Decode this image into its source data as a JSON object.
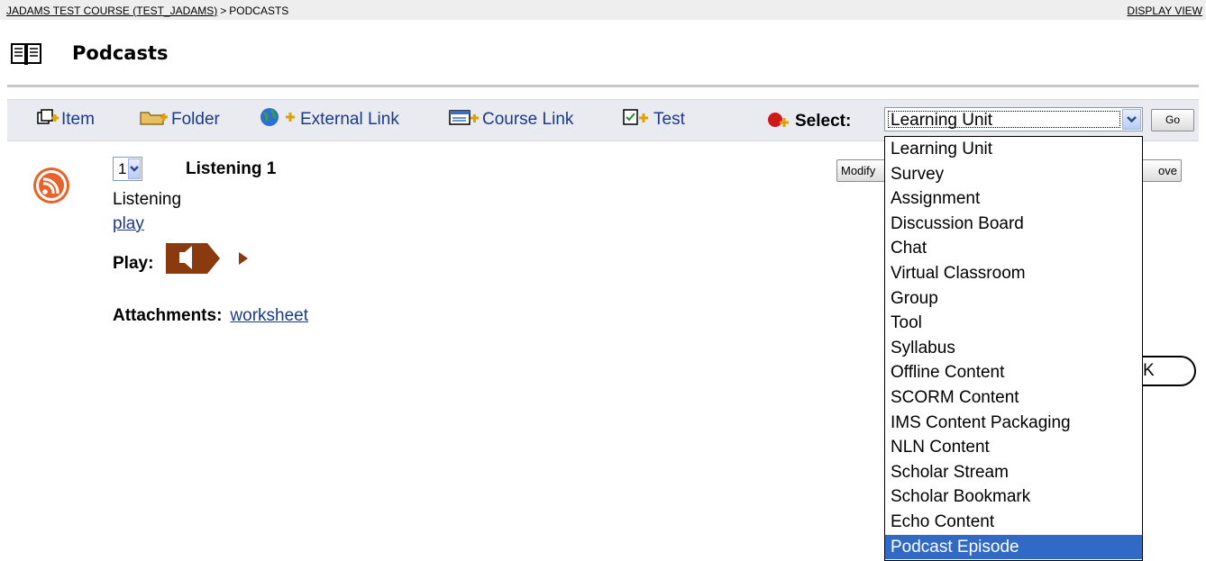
{
  "breadcrumb": {
    "course": "JADAMS TEST COURSE (TEST_JADAMS)",
    "separator": ">",
    "current": "PODCASTS",
    "display_view": "DISPLAY VIEW"
  },
  "page": {
    "title": "Podcasts",
    "icon": "book-icon"
  },
  "actions": {
    "item": "Item",
    "folder": "Folder",
    "external_link": "External Link",
    "course_link": "Course Link",
    "test": "Test",
    "select_label": "Select:",
    "select_value": "Learning Unit",
    "go": "Go"
  },
  "content_item": {
    "order": "1",
    "title": "Listening 1",
    "description": "Listening",
    "play_link": "play",
    "play_label": "Play:",
    "attachments_label": "Attachments:",
    "attachment": "worksheet",
    "modify": "Modify",
    "remove": "ove",
    "ok_fragment": "K"
  },
  "dropdown": {
    "options": [
      "Learning Unit",
      "Survey",
      "Assignment",
      "Discussion Board",
      "Chat",
      "Virtual Classroom",
      "Group",
      "Tool",
      "Syllabus",
      "Offline Content",
      "SCORM Content",
      "IMS Content Packaging",
      "NLN Content",
      "Scholar Stream",
      "Scholar Bookmark",
      "Echo Content",
      "Podcast Episode"
    ],
    "highlighted": "Podcast Episode"
  },
  "colors": {
    "link": "#1a3a8c",
    "highlight": "#316ac5",
    "podcast_orange": "#e8622a",
    "speaker_brown": "#8b3a0f"
  }
}
